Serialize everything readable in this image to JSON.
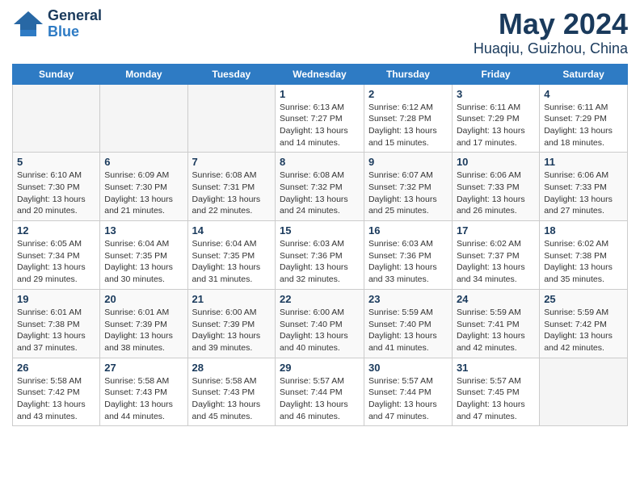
{
  "logo": {
    "line1": "General",
    "line2": "Blue"
  },
  "title": "May 2024",
  "subtitle": "Huaqiu, Guizhou, China",
  "days_of_week": [
    "Sunday",
    "Monday",
    "Tuesday",
    "Wednesday",
    "Thursday",
    "Friday",
    "Saturday"
  ],
  "weeks": [
    [
      {
        "day": "",
        "info": ""
      },
      {
        "day": "",
        "info": ""
      },
      {
        "day": "",
        "info": ""
      },
      {
        "day": "1",
        "info": "Sunrise: 6:13 AM\nSunset: 7:27 PM\nDaylight: 13 hours\nand 14 minutes."
      },
      {
        "day": "2",
        "info": "Sunrise: 6:12 AM\nSunset: 7:28 PM\nDaylight: 13 hours\nand 15 minutes."
      },
      {
        "day": "3",
        "info": "Sunrise: 6:11 AM\nSunset: 7:29 PM\nDaylight: 13 hours\nand 17 minutes."
      },
      {
        "day": "4",
        "info": "Sunrise: 6:11 AM\nSunset: 7:29 PM\nDaylight: 13 hours\nand 18 minutes."
      }
    ],
    [
      {
        "day": "5",
        "info": "Sunrise: 6:10 AM\nSunset: 7:30 PM\nDaylight: 13 hours\nand 20 minutes."
      },
      {
        "day": "6",
        "info": "Sunrise: 6:09 AM\nSunset: 7:30 PM\nDaylight: 13 hours\nand 21 minutes."
      },
      {
        "day": "7",
        "info": "Sunrise: 6:08 AM\nSunset: 7:31 PM\nDaylight: 13 hours\nand 22 minutes."
      },
      {
        "day": "8",
        "info": "Sunrise: 6:08 AM\nSunset: 7:32 PM\nDaylight: 13 hours\nand 24 minutes."
      },
      {
        "day": "9",
        "info": "Sunrise: 6:07 AM\nSunset: 7:32 PM\nDaylight: 13 hours\nand 25 minutes."
      },
      {
        "day": "10",
        "info": "Sunrise: 6:06 AM\nSunset: 7:33 PM\nDaylight: 13 hours\nand 26 minutes."
      },
      {
        "day": "11",
        "info": "Sunrise: 6:06 AM\nSunset: 7:33 PM\nDaylight: 13 hours\nand 27 minutes."
      }
    ],
    [
      {
        "day": "12",
        "info": "Sunrise: 6:05 AM\nSunset: 7:34 PM\nDaylight: 13 hours\nand 29 minutes."
      },
      {
        "day": "13",
        "info": "Sunrise: 6:04 AM\nSunset: 7:35 PM\nDaylight: 13 hours\nand 30 minutes."
      },
      {
        "day": "14",
        "info": "Sunrise: 6:04 AM\nSunset: 7:35 PM\nDaylight: 13 hours\nand 31 minutes."
      },
      {
        "day": "15",
        "info": "Sunrise: 6:03 AM\nSunset: 7:36 PM\nDaylight: 13 hours\nand 32 minutes."
      },
      {
        "day": "16",
        "info": "Sunrise: 6:03 AM\nSunset: 7:36 PM\nDaylight: 13 hours\nand 33 minutes."
      },
      {
        "day": "17",
        "info": "Sunrise: 6:02 AM\nSunset: 7:37 PM\nDaylight: 13 hours\nand 34 minutes."
      },
      {
        "day": "18",
        "info": "Sunrise: 6:02 AM\nSunset: 7:38 PM\nDaylight: 13 hours\nand 35 minutes."
      }
    ],
    [
      {
        "day": "19",
        "info": "Sunrise: 6:01 AM\nSunset: 7:38 PM\nDaylight: 13 hours\nand 37 minutes."
      },
      {
        "day": "20",
        "info": "Sunrise: 6:01 AM\nSunset: 7:39 PM\nDaylight: 13 hours\nand 38 minutes."
      },
      {
        "day": "21",
        "info": "Sunrise: 6:00 AM\nSunset: 7:39 PM\nDaylight: 13 hours\nand 39 minutes."
      },
      {
        "day": "22",
        "info": "Sunrise: 6:00 AM\nSunset: 7:40 PM\nDaylight: 13 hours\nand 40 minutes."
      },
      {
        "day": "23",
        "info": "Sunrise: 5:59 AM\nSunset: 7:40 PM\nDaylight: 13 hours\nand 41 minutes."
      },
      {
        "day": "24",
        "info": "Sunrise: 5:59 AM\nSunset: 7:41 PM\nDaylight: 13 hours\nand 42 minutes."
      },
      {
        "day": "25",
        "info": "Sunrise: 5:59 AM\nSunset: 7:42 PM\nDaylight: 13 hours\nand 42 minutes."
      }
    ],
    [
      {
        "day": "26",
        "info": "Sunrise: 5:58 AM\nSunset: 7:42 PM\nDaylight: 13 hours\nand 43 minutes."
      },
      {
        "day": "27",
        "info": "Sunrise: 5:58 AM\nSunset: 7:43 PM\nDaylight: 13 hours\nand 44 minutes."
      },
      {
        "day": "28",
        "info": "Sunrise: 5:58 AM\nSunset: 7:43 PM\nDaylight: 13 hours\nand 45 minutes."
      },
      {
        "day": "29",
        "info": "Sunrise: 5:57 AM\nSunset: 7:44 PM\nDaylight: 13 hours\nand 46 minutes."
      },
      {
        "day": "30",
        "info": "Sunrise: 5:57 AM\nSunset: 7:44 PM\nDaylight: 13 hours\nand 47 minutes."
      },
      {
        "day": "31",
        "info": "Sunrise: 5:57 AM\nSunset: 7:45 PM\nDaylight: 13 hours\nand 47 minutes."
      },
      {
        "day": "",
        "info": ""
      }
    ]
  ]
}
